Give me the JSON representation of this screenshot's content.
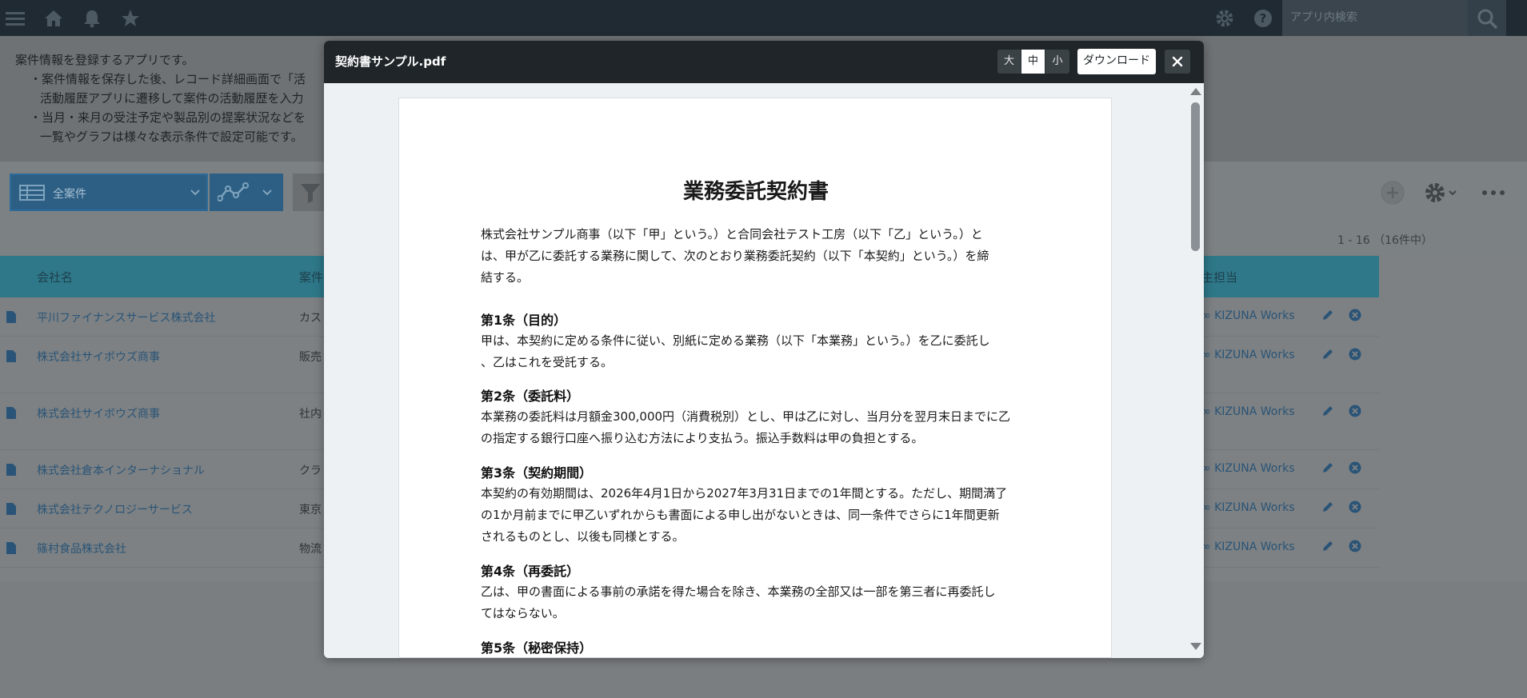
{
  "header": {
    "search_placeholder": "アプリ内検索",
    "icons": [
      "menu-icon",
      "home-icon",
      "bell-icon",
      "star-icon",
      "gear-icon",
      "help-icon",
      "search-icon"
    ]
  },
  "app_description": {
    "lines": [
      "案件情報を登録するアプリです。",
      "・案件情報を保存した後、レコード詳細画面で「活",
      "活動履歴アプリに遷移して案件の活動履歴を入力",
      "・当月・来月の受注予定や製品別の提案状況などを",
      "一覧やグラフは様々な表示条件で設定可能です。"
    ]
  },
  "view": {
    "selected": "全案件",
    "record_count": "1 - 16 （16件中）"
  },
  "table": {
    "headers": {
      "company": "会社名",
      "title": "案件",
      "owner": "主担当"
    },
    "rows": [
      {
        "company": "平川ファイナンスサービス株式会社",
        "title": "カス",
        "owner": "∞ KIZUNA Works"
      },
      {
        "company": "株式会社サイボウズ商事",
        "title": "販売",
        "owner": "∞ KIZUNA Works"
      },
      {
        "company": "株式会社サイボウズ商事",
        "title": "社内",
        "owner": "∞ KIZUNA Works"
      },
      {
        "company": "株式会社倉本インターナショナル",
        "title": "クラ",
        "owner": "∞ KIZUNA Works"
      },
      {
        "company": "株式会社テクノロジーサービス",
        "title": "東京",
        "owner": "∞ KIZUNA Works"
      },
      {
        "company": "篠村食品株式会社",
        "title": "物流",
        "owner": "∞ KIZUNA Works"
      }
    ]
  },
  "modal": {
    "title": "契約書サンプル.pdf",
    "zoom": {
      "large": "大",
      "medium": "中",
      "small": "小"
    },
    "download_label": "ダウンロード",
    "document": {
      "title": "業務委託契約書",
      "intro": [
        "株式会社サンプル商事（以下「甲」という。）と合同会社テスト工房（以下「乙」という。）と",
        "は、甲が乙に委託する業務に関して、次のとおり業務委託契約（以下「本契約」という。）を締",
        "結する。"
      ],
      "articles": [
        {
          "heading": "第1条（目的）",
          "lines": [
            "甲は、本契約に定める条件に従い、別紙に定める業務（以下「本業務」という。）を乙に委託し",
            "、乙はこれを受託する。"
          ]
        },
        {
          "heading": "第2条（委託料）",
          "lines": [
            "本業務の委託料は月額金300,000円（消費税別）とし、甲は乙に対し、当月分を翌月末日までに乙",
            "の指定する銀行口座へ振り込む方法により支払う。振込手数料は甲の負担とする。"
          ]
        },
        {
          "heading": "第3条（契約期間）",
          "lines": [
            "本契約の有効期間は、2026年4月1日から2027年3月31日までの1年間とする。ただし、期間満了",
            "の1か月前までに甲乙いずれからも書面による申し出がないときは、同一条件でさらに1年間更新",
            "されるものとし、以後も同様とする。"
          ]
        },
        {
          "heading": "第4条（再委託）",
          "lines": [
            "乙は、甲の書面による事前の承諾を得た場合を除き、本業務の全部又は一部を第三者に再委託し",
            "てはならない。"
          ]
        },
        {
          "heading": "第5条（秘密保持）",
          "lines": []
        }
      ]
    }
  }
}
